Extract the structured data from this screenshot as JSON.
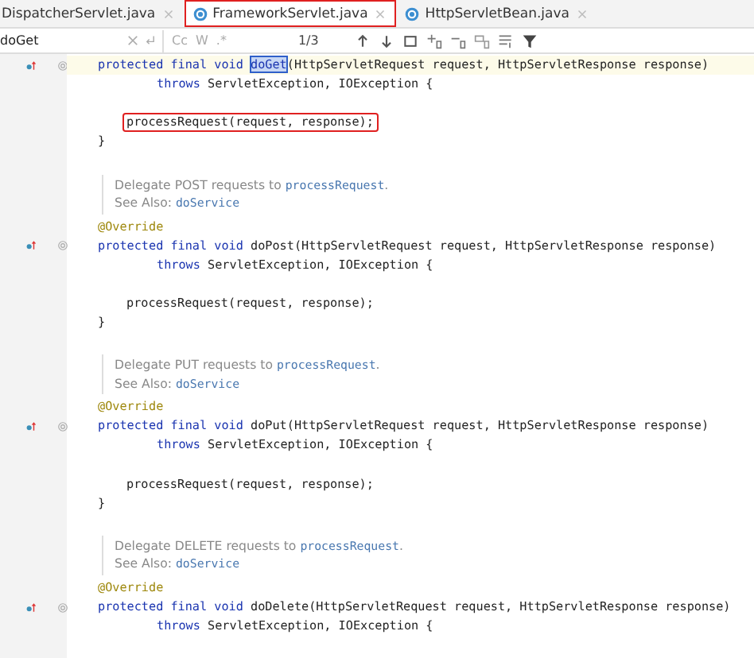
{
  "tabs": [
    {
      "label": "DispatcherServlet.java",
      "selected": false,
      "outlined": false
    },
    {
      "label": "FrameworkServlet.java",
      "selected": true,
      "outlined": true
    },
    {
      "label": "HttpServletBean.java",
      "selected": false,
      "outlined": false
    }
  ],
  "search": {
    "value": "doGet",
    "options": [
      "Cc",
      "W",
      ".*"
    ],
    "match_count": "1/3"
  },
  "lines": [
    {
      "kind": "signature",
      "current": true,
      "outlined": false,
      "segments": [
        {
          "t": "protected final void ",
          "kind": "keyword"
        },
        {
          "t": "doGet",
          "kind": "match"
        },
        {
          "t": "(HttpServletRequest request, HttpServletResponse response)",
          "kind": "plain"
        }
      ]
    },
    {
      "kind": "continuation",
      "current": false,
      "outlined": false,
      "segments": [
        {
          "t": "throws ",
          "kind": "keyword"
        },
        {
          "t": "ServletException, IOException {",
          "kind": "plain"
        }
      ]
    },
    {
      "kind": "blank"
    },
    {
      "kind": "body",
      "current": false,
      "outlined": true,
      "segments": [
        {
          "t": "processRequest(request, response);",
          "kind": "plain"
        }
      ]
    },
    {
      "kind": "close",
      "current": false,
      "outlined": false,
      "segments": [
        {
          "t": "}",
          "kind": "plain"
        }
      ]
    },
    {
      "kind": "blank"
    },
    {
      "kind": "doc",
      "rows": [
        {
          "text": "Delegate POST requests to ",
          "link": "processRequest",
          "tail": "."
        },
        {
          "text": "See Also: ",
          "link": "doService",
          "tail": ""
        }
      ]
    },
    {
      "kind": "annotation",
      "current": false,
      "outlined": false,
      "segments": [
        {
          "t": "@Override",
          "kind": "annotation"
        }
      ]
    },
    {
      "kind": "signature",
      "current": false,
      "outlined": false,
      "segments": [
        {
          "t": "protected final void ",
          "kind": "keyword"
        },
        {
          "t": "doPost(HttpServletRequest request, HttpServletResponse response)",
          "kind": "plain"
        }
      ]
    },
    {
      "kind": "continuation",
      "current": false,
      "outlined": false,
      "segments": [
        {
          "t": "throws ",
          "kind": "keyword"
        },
        {
          "t": "ServletException, IOException {",
          "kind": "plain"
        }
      ]
    },
    {
      "kind": "blank"
    },
    {
      "kind": "body",
      "current": false,
      "outlined": false,
      "segments": [
        {
          "t": "processRequest(request, response);",
          "kind": "plain"
        }
      ]
    },
    {
      "kind": "close",
      "current": false,
      "outlined": false,
      "segments": [
        {
          "t": "}",
          "kind": "plain"
        }
      ]
    },
    {
      "kind": "blank"
    },
    {
      "kind": "doc",
      "rows": [
        {
          "text": "Delegate PUT requests to ",
          "link": "processRequest",
          "tail": "."
        },
        {
          "text": "See Also: ",
          "link": "doService",
          "tail": ""
        }
      ]
    },
    {
      "kind": "annotation",
      "current": false,
      "outlined": false,
      "segments": [
        {
          "t": "@Override",
          "kind": "annotation"
        }
      ]
    },
    {
      "kind": "signature",
      "current": false,
      "outlined": false,
      "segments": [
        {
          "t": "protected final void ",
          "kind": "keyword"
        },
        {
          "t": "doPut(HttpServletRequest request, HttpServletResponse response)",
          "kind": "plain"
        }
      ]
    },
    {
      "kind": "continuation",
      "current": false,
      "outlined": false,
      "segments": [
        {
          "t": "throws ",
          "kind": "keyword"
        },
        {
          "t": "ServletException, IOException {",
          "kind": "plain"
        }
      ]
    },
    {
      "kind": "blank"
    },
    {
      "kind": "body",
      "current": false,
      "outlined": false,
      "segments": [
        {
          "t": "processRequest(request, response);",
          "kind": "plain"
        }
      ]
    },
    {
      "kind": "close",
      "current": false,
      "outlined": false,
      "segments": [
        {
          "t": "}",
          "kind": "plain"
        }
      ]
    },
    {
      "kind": "blank"
    },
    {
      "kind": "doc",
      "rows": [
        {
          "text": "Delegate DELETE requests to ",
          "link": "processRequest",
          "tail": "."
        },
        {
          "text": "See Also: ",
          "link": "doService",
          "tail": ""
        }
      ]
    },
    {
      "kind": "annotation",
      "current": false,
      "outlined": false,
      "segments": [
        {
          "t": "@Override",
          "kind": "annotation"
        }
      ]
    },
    {
      "kind": "signature",
      "current": false,
      "outlined": false,
      "segments": [
        {
          "t": "protected final void ",
          "kind": "keyword"
        },
        {
          "t": "doDelete(HttpServletRequest request, HttpServletResponse response)",
          "kind": "plain"
        }
      ]
    },
    {
      "kind": "continuation",
      "current": false,
      "outlined": false,
      "segments": [
        {
          "t": "throws ",
          "kind": "keyword"
        },
        {
          "t": "ServletException, IOException {",
          "kind": "plain"
        }
      ]
    }
  ]
}
